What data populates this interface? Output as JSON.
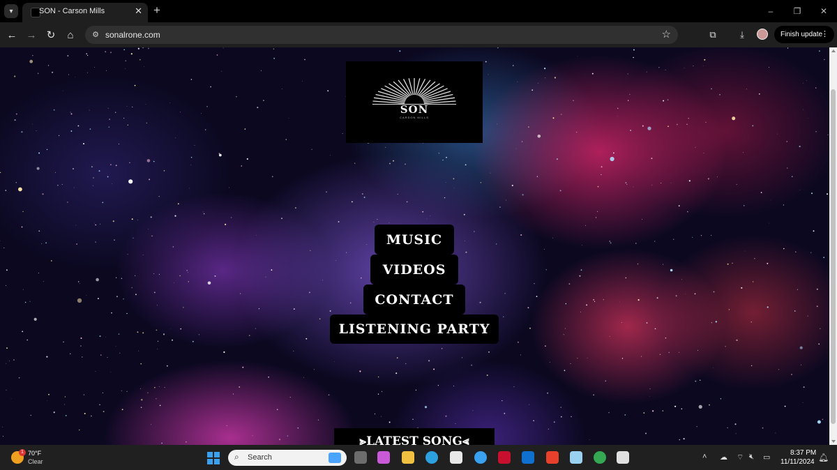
{
  "browser": {
    "tab_title": "SON - Carson Mills",
    "close_glyph": "✕",
    "new_tab_glyph": "+",
    "url": "sonalrone.com",
    "finish_update_label": "Finish update",
    "window_controls": [
      "–",
      "❐",
      "✕"
    ],
    "nav_glyphs": {
      "back": "←",
      "forward": "→",
      "reload": "↻",
      "home": "⌂"
    },
    "icons": [
      "tab-search-icon",
      "back-arrow-icon",
      "forward-arrow-icon",
      "reload-icon",
      "home-icon",
      "site-info-icon",
      "bookmark-star-icon",
      "extensions-icon",
      "download-icon",
      "profile-avatar-icon",
      "kebab-menu-icon"
    ]
  },
  "site": {
    "logo": {
      "text": "SON",
      "subtext": "CARSON MILLS"
    },
    "nav": [
      "MUSIC",
      "VIDEOS",
      "CONTACT",
      "LISTENING PARTY"
    ],
    "latest_song": "⪢LATEST SONG⪡"
  },
  "taskbar": {
    "weather_temp": "70°F",
    "weather_condition": "Clear",
    "weather_badge": "1",
    "search_placeholder": "Search",
    "time": "8:37 PM",
    "date": "11/11/2024",
    "apps": [
      "start-icon",
      "task-view-icon",
      "copilot-icon",
      "file-explorer-icon",
      "edge-icon",
      "microsoft-store-icon",
      "norton-icon",
      "mcafee-icon",
      "outlook-icon",
      "red-app-icon",
      "photos-icon",
      "chrome-icon",
      "snipping-tool-icon"
    ],
    "app_colors": [
      "#6d6d6d",
      "#c85ad8",
      "#f0c040",
      "#2da0e0",
      "#e8e8e8",
      "#3aa0f0",
      "#c8102e",
      "#1070d0",
      "#e8402a",
      "#9ad0f0",
      "#34a853",
      "#e0e0e0"
    ]
  },
  "colors": {
    "nav_button_bg": "#000000",
    "nav_button_text": "#ffffff",
    "browser_chrome": "#1f1f1f",
    "taskbar": "#202020"
  }
}
